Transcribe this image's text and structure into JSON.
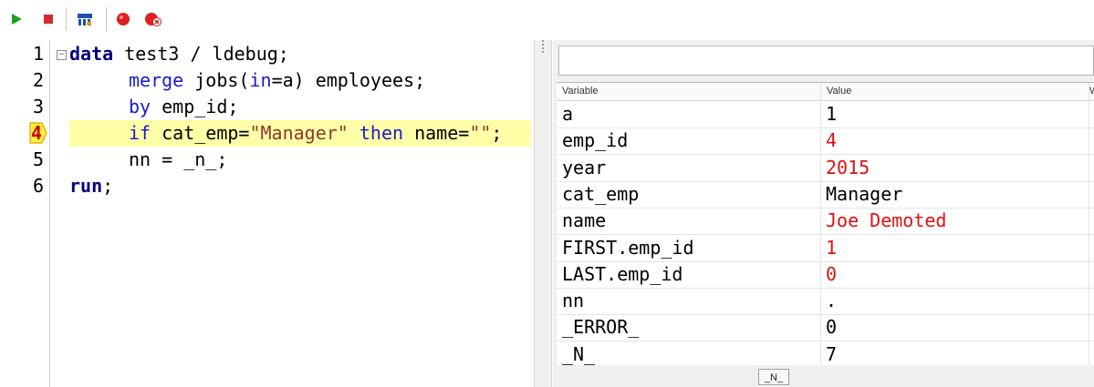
{
  "editor": {
    "line_numbers": [
      "1",
      "2",
      "3",
      "4",
      "5",
      "6"
    ],
    "current_line": "4",
    "lines": [
      {
        "a": "data",
        "b": " test3 / ldebug;"
      },
      {
        "a": "merge",
        "b": " jobs(",
        "c": "in",
        "d": "=a) employees;"
      },
      {
        "a": "by",
        "b": " emp_id;"
      },
      {
        "a": "if",
        "b": " cat_emp=",
        "c": "\"Manager\"",
        "d": " ",
        "e": "then",
        "f": " name=",
        "g": "\"\"",
        "h": ";"
      },
      {
        "a": "nn = _n_;"
      },
      {
        "a": "run",
        "b": ";"
      }
    ]
  },
  "watch": {
    "columns": [
      "Variable",
      "Value",
      "W"
    ],
    "rows": [
      {
        "variable": "a",
        "value": "1",
        "changed": false
      },
      {
        "variable": "emp_id",
        "value": "4",
        "changed": true
      },
      {
        "variable": "year",
        "value": "2015",
        "changed": true
      },
      {
        "variable": "cat_emp",
        "value": "Manager",
        "changed": false
      },
      {
        "variable": "name",
        "value": "Joe Demoted",
        "changed": true
      },
      {
        "variable": "FIRST.emp_id",
        "value": "1",
        "changed": true
      },
      {
        "variable": "LAST.emp_id",
        "value": "0",
        "changed": true
      },
      {
        "variable": "nn",
        "value": ".",
        "changed": false
      },
      {
        "variable": "_ERROR_",
        "value": "0",
        "changed": false
      },
      {
        "variable": "_N_",
        "value": "7",
        "changed": false
      }
    ],
    "status_tab": "_N_"
  },
  "colors": {
    "changed_value": "#e01010",
    "highlight": "#ffffa8",
    "keyword": "#1a1acd"
  },
  "toolbar": {
    "icons": [
      "run-icon",
      "stop-icon",
      "step-over-icon",
      "breakpoint-icon",
      "clear-breakpoints-icon"
    ]
  }
}
